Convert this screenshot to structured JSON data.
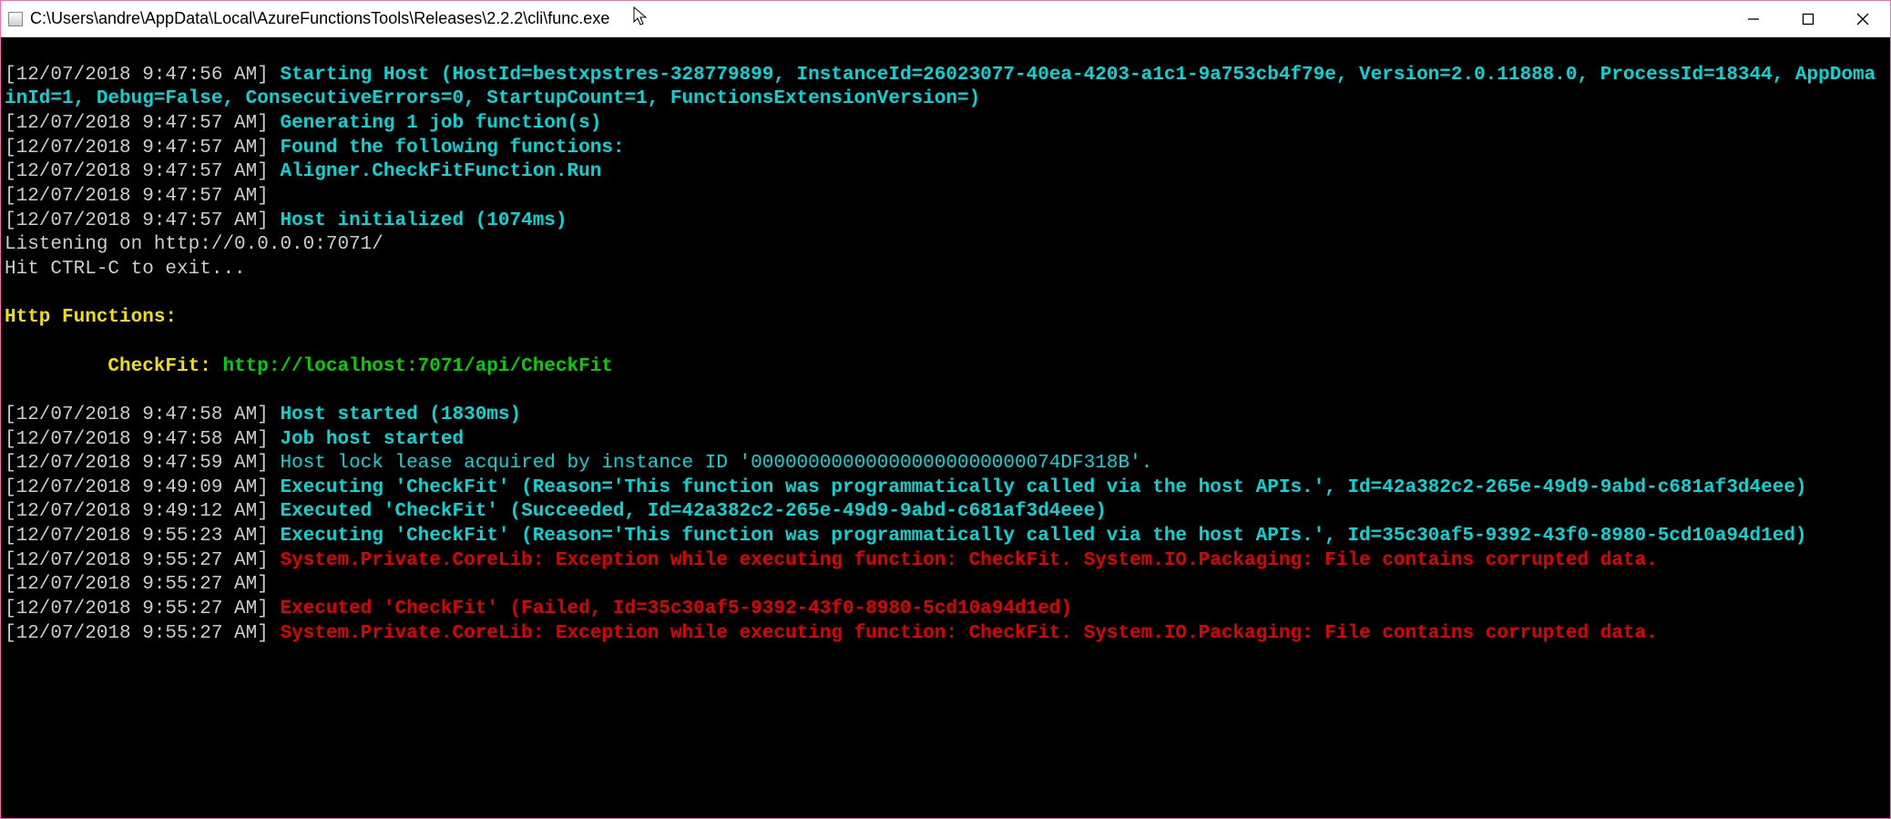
{
  "titlebar": {
    "path": "C:\\Users\\andre\\AppData\\Local\\AzureFunctionsTools\\Releases\\2.2.2\\cli\\func.exe"
  },
  "log": {
    "ts1": "[12/07/2018 9:47:56 AM]",
    "msg1": " Starting Host (HostId=bestxpstres-328779899, InstanceId=26023077-40ea-4203-a1c1-9a753cb4f79e, Version=2.0.11888.0, ProcessId=18344, AppDomainId=1, Debug=False, ConsecutiveErrors=0, StartupCount=1, FunctionsExtensionVersion=)",
    "ts2": "[12/07/2018 9:47:57 AM]",
    "msg2": " Generating 1 job function(s)",
    "ts3": "[12/07/2018 9:47:57 AM]",
    "msg3": " Found the following functions:",
    "ts4": "[12/07/2018 9:47:57 AM]",
    "msg4": " Aligner.CheckFitFunction.Run",
    "ts5": "[12/07/2018 9:47:57 AM]",
    "ts6": "[12/07/2018 9:47:57 AM]",
    "msg6": " Host initialized (1074ms)",
    "listen": "Listening on http://0.0.0.0:7071/",
    "ctrlc": "Hit CTRL-C to exit...",
    "httpfns": "Http Functions:",
    "fnname": "CheckFit: ",
    "fnurl": "http://localhost:7071/api/CheckFit",
    "ts7": "[12/07/2018 9:47:58 AM]",
    "msg7": " Host started (1830ms)",
    "ts8": "[12/07/2018 9:47:58 AM]",
    "msg8": " Job host started",
    "ts9": "[12/07/2018 9:47:59 AM]",
    "msg9": " Host lock lease acquired by instance ID '000000000000000000000000074DF318B'.",
    "ts10": "[12/07/2018 9:49:09 AM]",
    "msg10": " Executing 'CheckFit' (Reason='This function was programmatically called via the host APIs.', Id=42a382c2-265e-49d9-9abd-c681af3d4eee)",
    "ts11": "[12/07/2018 9:49:12 AM]",
    "msg11": " Executed 'CheckFit' (Succeeded, Id=42a382c2-265e-49d9-9abd-c681af3d4eee)",
    "ts12": "[12/07/2018 9:55:23 AM]",
    "msg12": " Executing 'CheckFit' (Reason='This function was programmatically called via the host APIs.', Id=35c30af5-9392-43f0-8980-5cd10a94d1ed)",
    "ts13": "[12/07/2018 9:55:27 AM]",
    "msg13": " System.Private.CoreLib: Exception while executing function: CheckFit. System.IO.Packaging: File contains corrupted data.",
    "ts14": "[12/07/2018 9:55:27 AM]",
    "ts15": "[12/07/2018 9:55:27 AM]",
    "msg15": " Executed 'CheckFit' (Failed, Id=35c30af5-9392-43f0-8980-5cd10a94d1ed)",
    "ts16": "[12/07/2018 9:55:27 AM]",
    "msg16": " System.Private.CoreLib: Exception while executing function: CheckFit. System.IO.Packaging: File contains corrupted data."
  }
}
